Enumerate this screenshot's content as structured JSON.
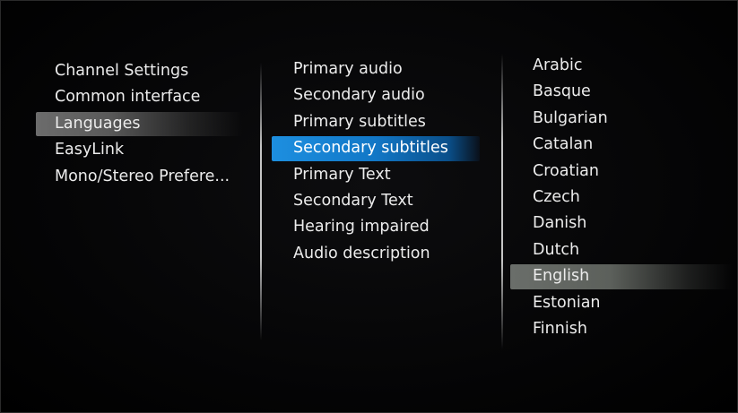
{
  "menu": {
    "items": [
      {
        "label": "Channel Settings"
      },
      {
        "label": "Common interface"
      },
      {
        "label": "Languages"
      },
      {
        "label": "EasyLink"
      },
      {
        "label": "Mono/Stereo Prefere..."
      }
    ],
    "selected_index": 2
  },
  "submenu": {
    "items": [
      {
        "label": "Primary audio"
      },
      {
        "label": "Secondary audio"
      },
      {
        "label": "Primary subtitles"
      },
      {
        "label": "Secondary subtitles"
      },
      {
        "label": "Primary Text"
      },
      {
        "label": "Secondary Text"
      },
      {
        "label": "Hearing impaired"
      },
      {
        "label": "Audio description"
      }
    ],
    "selected_index": 3
  },
  "options": {
    "items": [
      {
        "label": "Arabic"
      },
      {
        "label": "Basque"
      },
      {
        "label": "Bulgarian"
      },
      {
        "label": "Catalan"
      },
      {
        "label": "Croatian"
      },
      {
        "label": "Czech"
      },
      {
        "label": "Danish"
      },
      {
        "label": "Dutch"
      },
      {
        "label": "English"
      },
      {
        "label": "Estonian"
      },
      {
        "label": "Finnish"
      }
    ],
    "selected_index": 8
  },
  "colors": {
    "background": "#000000",
    "text": "#ececec",
    "focus_highlight": "#1d8fe0",
    "selection_highlight": "#6c6c6c"
  }
}
